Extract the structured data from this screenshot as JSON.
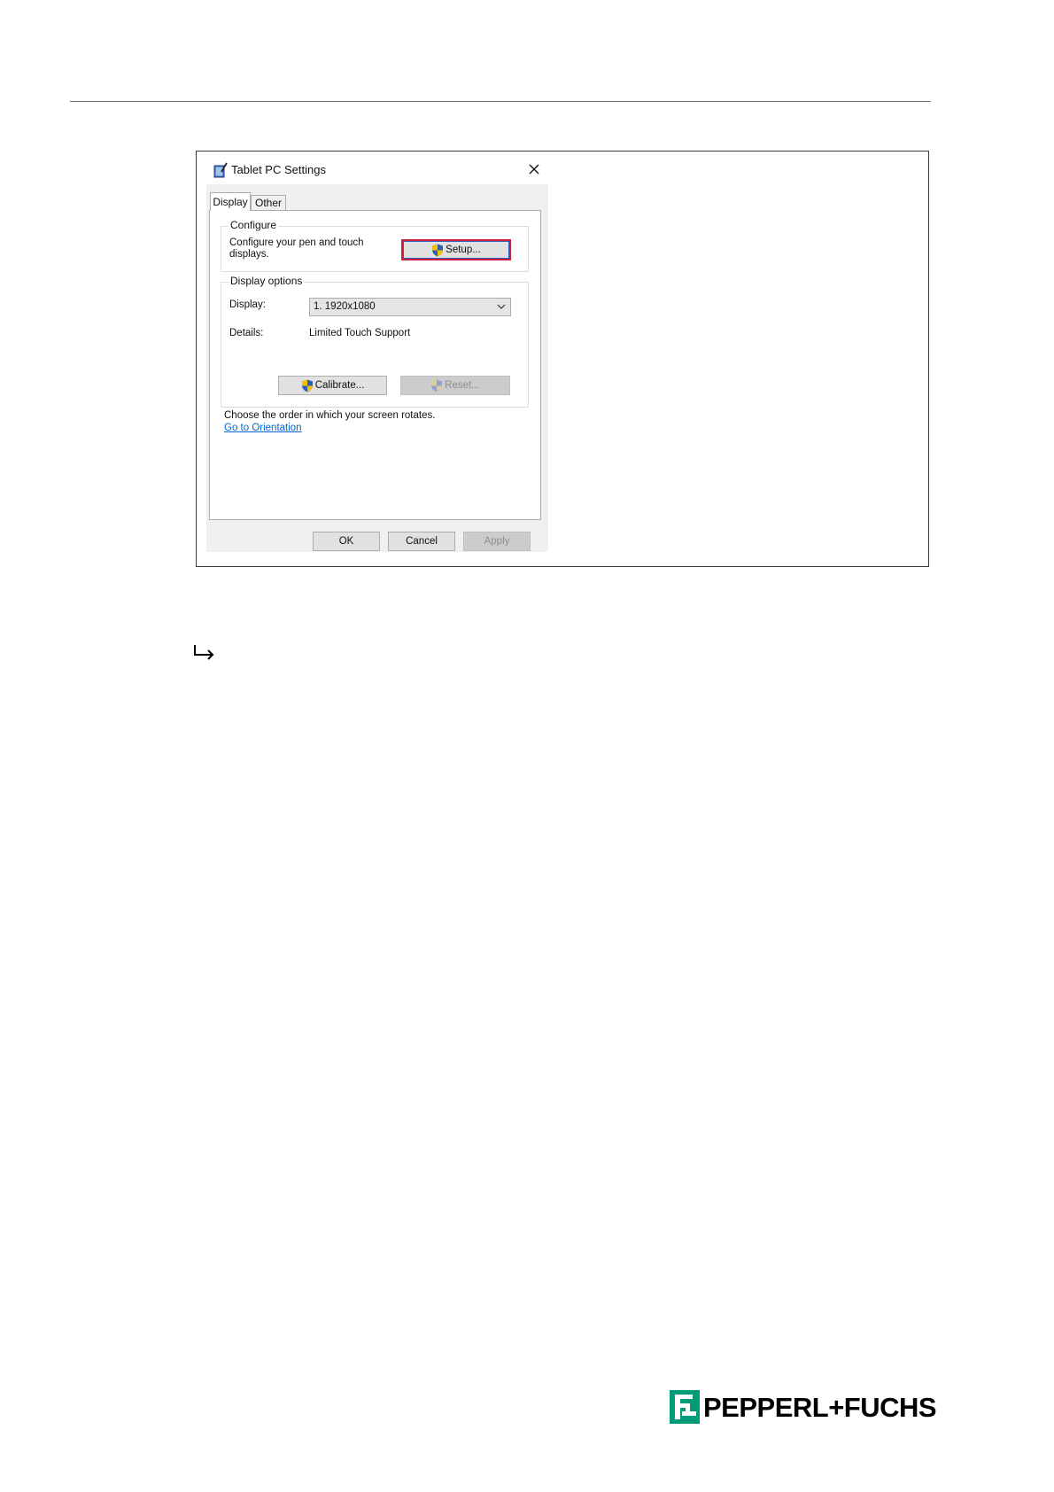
{
  "dialog": {
    "title": "Tablet PC Settings",
    "tabs": [
      {
        "label": "Display",
        "selected": true
      },
      {
        "label": "Other",
        "selected": false
      }
    ],
    "configure": {
      "legend": "Configure",
      "description": "Configure your pen and touch displays.",
      "setup_label": "Setup..."
    },
    "display_options": {
      "legend": "Display options",
      "display_label": "Display:",
      "display_value": "1. 1920x1080",
      "details_label": "Details:",
      "details_value": "Limited Touch Support",
      "calibrate_label": "Calibrate...",
      "reset_label": "Reset..."
    },
    "orientation": {
      "text": "Choose the order in which your screen rotates.",
      "link": "Go to Orientation"
    },
    "buttons": {
      "ok": "OK",
      "cancel": "Cancel",
      "apply": "Apply"
    }
  },
  "icons": {
    "app": "tablet-pen-icon",
    "close": "close-icon",
    "shield": "uac-shield-icon",
    "chevron": "chevron-down-icon",
    "result": "result-arrow-icon"
  },
  "colors": {
    "highlight_border": "#d01d3b",
    "link": "#0066cc",
    "brand": "#009b77"
  },
  "brand": {
    "name": "PEPPERL+FUCHS"
  }
}
